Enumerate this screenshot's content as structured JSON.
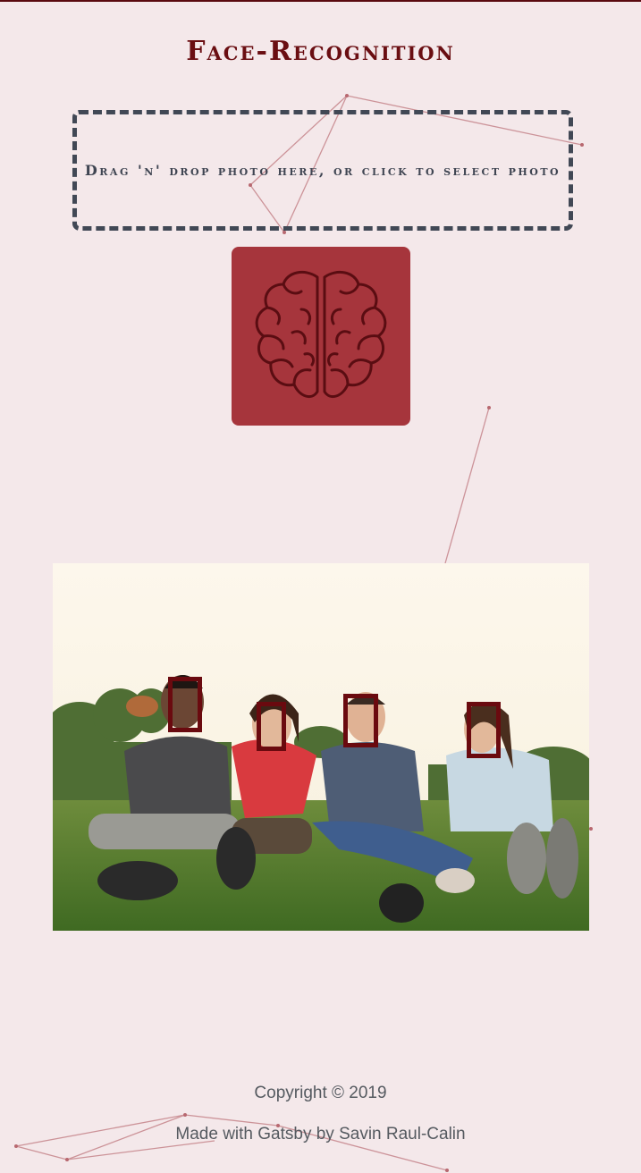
{
  "header": {
    "title": "Face-Recognition"
  },
  "dropzone": {
    "text": "Drag 'n' drop photo here, or click to select photo"
  },
  "detect_button": {
    "icon": "brain-icon",
    "color": "#a6353c"
  },
  "photo": {
    "detected_faces": 4
  },
  "footer": {
    "copyright": "Copyright © 2019",
    "credit": "Made with Gatsby by Savin Raul-Calin"
  },
  "colors": {
    "background": "#f4e8ea",
    "accent": "#6a0e12",
    "button": "#a6353c",
    "dropzone_border": "#414855"
  }
}
